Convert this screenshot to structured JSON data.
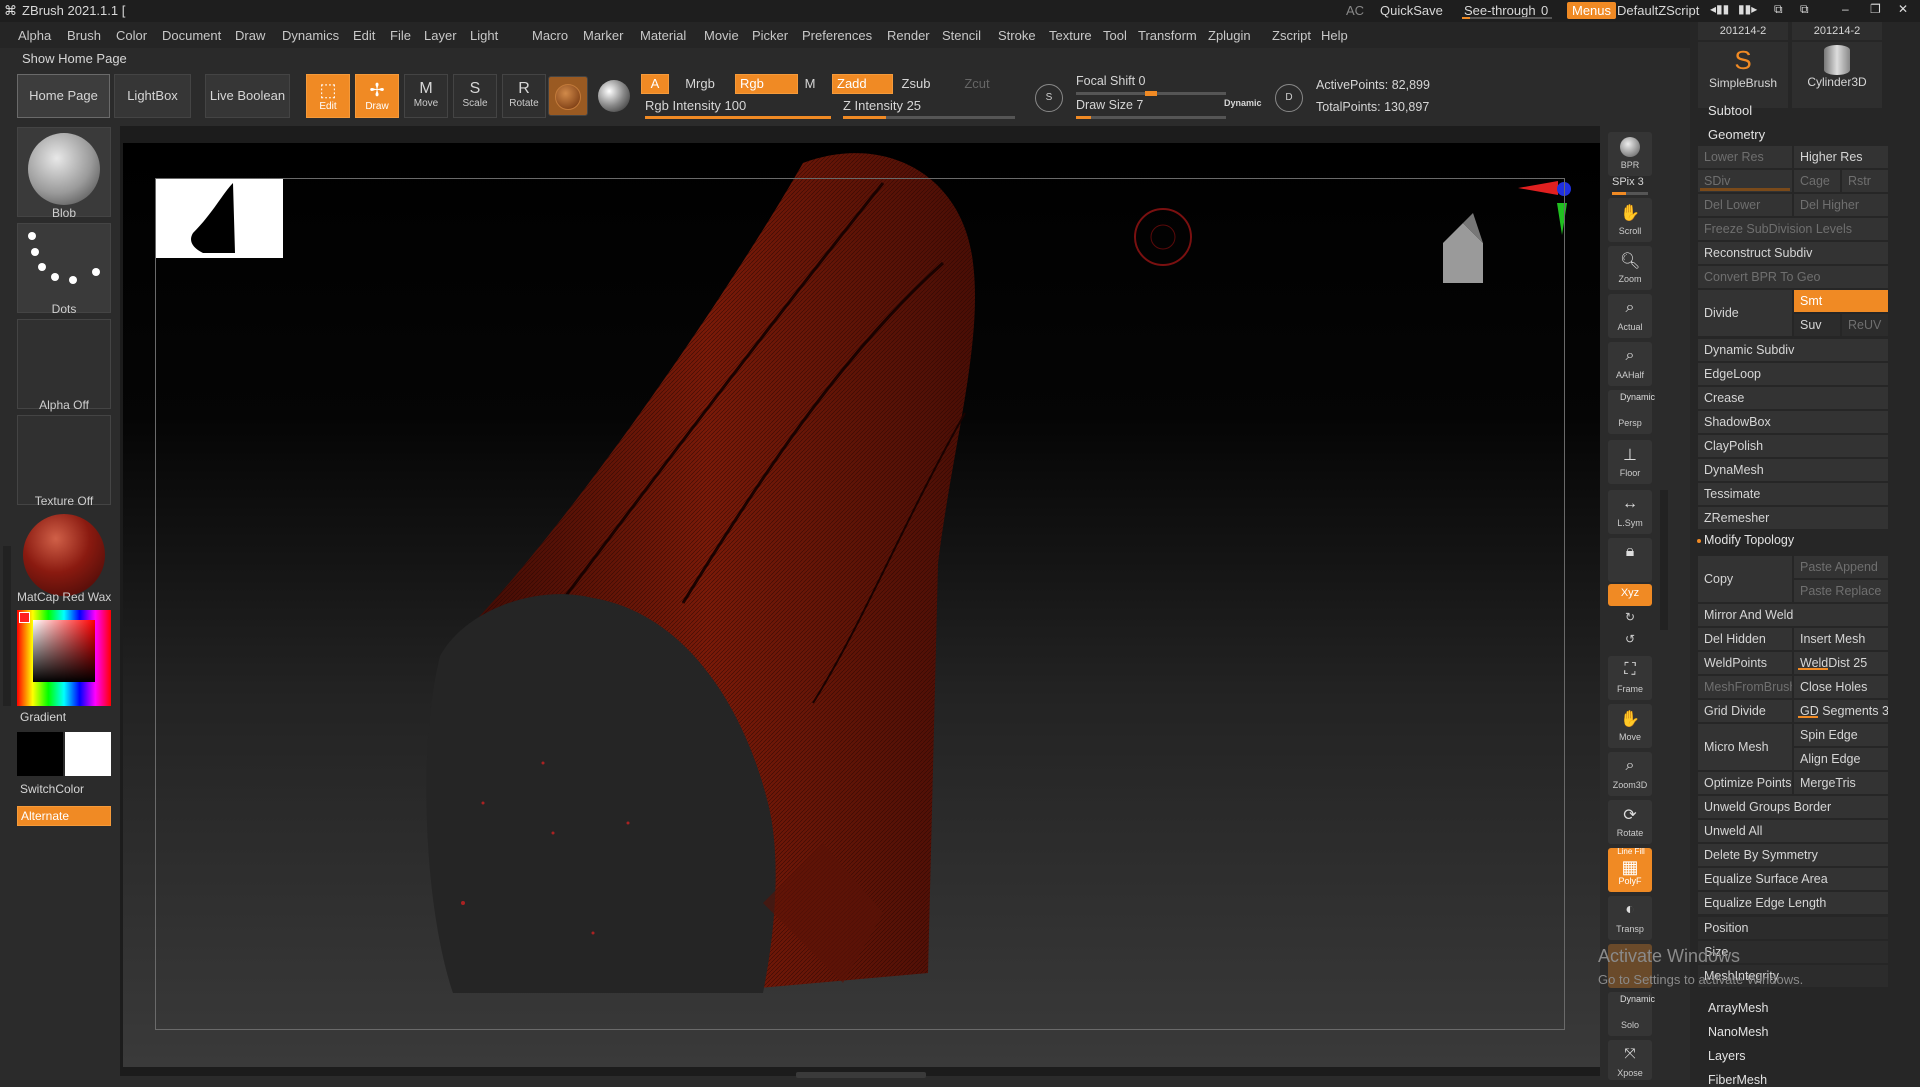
{
  "app": {
    "title": "ZBrush 2021.1.1 [",
    "ac_label": "AC",
    "quicksave": "QuickSave",
    "see_through": "See-through",
    "see_through_value": "0",
    "menus": "Menus",
    "script_name": "DefaultZScript"
  },
  "menu": [
    "Alpha",
    "Brush",
    "Color",
    "Document",
    "Draw",
    "Dynamics",
    "Edit",
    "File",
    "Layer",
    "Light",
    "Macro",
    "Marker",
    "Material",
    "Movie",
    "Picker",
    "Preferences",
    "Render",
    "Stencil",
    "Stroke",
    "Texture",
    "Tool",
    "Transform",
    "Zplugin",
    "Zscript",
    "Help"
  ],
  "home_header": "Show Home Page",
  "shelf": {
    "home_page": "Home Page",
    "lightbox": "LightBox",
    "live_boolean": "Live Boolean",
    "edit": "Edit",
    "draw": "Draw",
    "move": "Move",
    "scale": "Scale",
    "rotate": "Rotate",
    "a": "A",
    "mrgb": "Mrgb",
    "rgb": "Rgb",
    "m": "M",
    "zadd": "Zadd",
    "zsub": "Zsub",
    "zcut": "Zcut",
    "rgb_intensity": "Rgb Intensity 100",
    "z_intensity": "Z Intensity 25",
    "focal_shift": "Focal Shift 0",
    "draw_size": "Draw Size 7",
    "dynamic": "Dynamic",
    "active_points": "ActivePoints: 82,899",
    "total_points": "TotalPoints: 130,897",
    "rgb_intensity_value": 1.0,
    "z_intensity_value": 0.25,
    "focal_shift_value": 0.5,
    "draw_size_value": 0.1
  },
  "left": {
    "brush": "Blob",
    "stroke": "Dots",
    "alpha": "Alpha Off",
    "texture": "Texture Off",
    "material": "MatCap Red Wax",
    "gradient": "Gradient",
    "switch_color": "SwitchColor",
    "alternate": "Alternate"
  },
  "right_shelf": [
    "BPR",
    "SPix 3",
    "Scroll",
    "Zoom",
    "Actual",
    "AAHalf",
    "Persp",
    "Floor",
    "L.Sym",
    "",
    "Xyz",
    "",
    "",
    "Frame",
    "Move",
    "Zoom3D",
    "Rotate",
    "PolyF",
    "Transp",
    "",
    "Solo",
    "Xpose"
  ],
  "right_shelf_labels": {
    "dynamic": "Dynamic",
    "line_fill": "Line Fill"
  },
  "tools": {
    "tool1_id": "201214-2",
    "tool2_id": "201214-2",
    "tool1": "SimpleBrush",
    "tool2": "Cylinder3D"
  },
  "panel": {
    "subtool": "Subtool",
    "geometry": "Geometry",
    "lower_res": "Lower Res",
    "higher_res": "Higher Res",
    "sdiv": "SDiv",
    "cage": "Cage",
    "rstr": "Rstr",
    "del_lower": "Del Lower",
    "del_higher": "Del Higher",
    "freeze": "Freeze SubDivision Levels",
    "reconstruct": "Reconstruct Subdiv",
    "convert_bpr": "Convert BPR To Geo",
    "divide": "Divide",
    "smt": "Smt",
    "suv": "Suv",
    "reuv": "ReUV",
    "dynamic_subdiv": "Dynamic Subdiv",
    "edgeloop": "EdgeLoop",
    "crease": "Crease",
    "shadowbox": "ShadowBox",
    "claypolish": "ClayPolish",
    "dynamesh": "DynaMesh",
    "tessimate": "Tessimate",
    "zremesher": "ZRemesher",
    "modify_topology": "Modify Topology",
    "copy": "Copy",
    "paste_append": "Paste Append",
    "paste_replace": "Paste Replace",
    "mirror_weld": "Mirror And Weld",
    "del_hidden": "Del Hidden",
    "insert_mesh": "Insert Mesh",
    "weldpoints": "WeldPoints",
    "welddist": "WeldDist 25",
    "meshfrombrush": "MeshFromBrush",
    "close_holes": "Close Holes",
    "grid_divide": "Grid Divide",
    "gd_segments": "GD Segments 3",
    "spin_edge": "Spin Edge",
    "micro_mesh": "Micro Mesh",
    "align_edge": "Align Edge",
    "optimize_points": "Optimize Points",
    "mergetris": "MergeTris",
    "unweld_groups": "Unweld Groups Border",
    "unweld_all": "Unweld All",
    "delete_by_symmetry": "Delete By Symmetry",
    "equalize_surface": "Equalize Surface Area",
    "equalize_edge": "Equalize Edge Length",
    "position": "Position",
    "size": "Size",
    "meshintegrity": "MeshIntegrity",
    "arraymesh": "ArrayMesh",
    "nanomesh": "NanoMesh",
    "layers": "Layers",
    "fibermesh": "FiberMesh"
  },
  "watermark": {
    "line1": "Activate Windows",
    "line2": "Go to Settings to activate Windows."
  },
  "colors": {
    "accent": "#f08a24",
    "mesh": "#8a1a08",
    "panel": "#262626"
  }
}
